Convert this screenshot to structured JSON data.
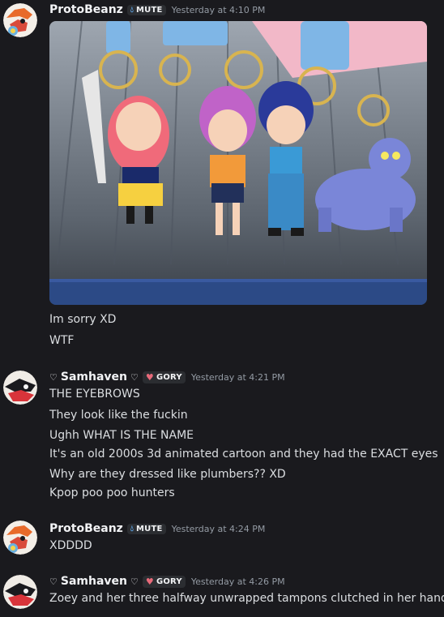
{
  "messages": [
    {
      "username": "ProtoBeanz",
      "badge": "MUTE",
      "timestamp": "Yesterday at 4:10 PM",
      "lines": [
        "Im sorry XD",
        "WTF"
      ]
    },
    {
      "username": "Samhaven",
      "name_prefix": "♡",
      "name_suffix": "♡",
      "badge": "GORY",
      "timestamp": "Yesterday at 4:21 PM",
      "lines": [
        "THE EYEBROWS",
        "They look like the fuckin",
        "Ughh WHAT IS THE NAME",
        "It's an old 2000s 3d animated cartoon and they had the EXACT eyes",
        "Why are they dressed like plumbers?? XD",
        "Kpop poo poo hunters"
      ]
    },
    {
      "username": "ProtoBeanz",
      "badge": "MUTE",
      "timestamp": "Yesterday at 4:24 PM",
      "lines": [
        "XDDDD"
      ]
    },
    {
      "username": "Samhaven",
      "name_prefix": "♡",
      "name_suffix": "♡",
      "badge": "GORY",
      "timestamp": "Yesterday at 4:26 PM",
      "lines": [
        "Zoey and her three halfway unwrapped tampons clutched in her hand"
      ]
    }
  ],
  "icons": {
    "mute_badge_icon": "water-drop-icon",
    "gory_badge_icon": "heart-icon"
  },
  "colors": {
    "background": "#1a1a1e",
    "text": "#dbdee1",
    "username": "#f2f3f5",
    "timestamp": "#949ba4",
    "mute_icon": "#5ea6e8",
    "gory_icon": "#e86a7a"
  }
}
